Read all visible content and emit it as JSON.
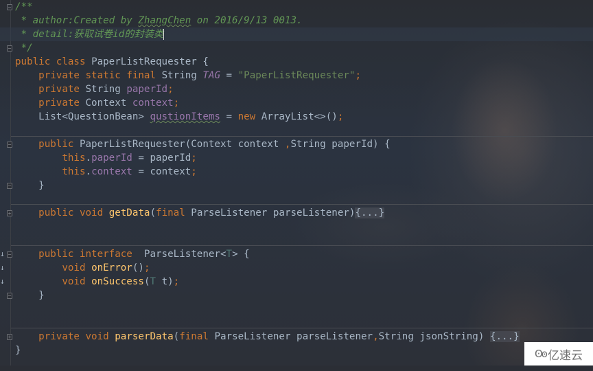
{
  "editor": {
    "theme": "dark",
    "colors": {
      "keyword": "#cc7832",
      "comment": "#629755",
      "string": "#6a8759",
      "field": "#9876aa",
      "method": "#ffc66d",
      "default": "#a9b7c6"
    },
    "lines": {
      "l1": {
        "text": "/**"
      },
      "l2": {
        "star": " * ",
        "tag": "author:",
        "text1": "Created by ",
        "name": "ZhangChen",
        "text2": " on 2016/9/13 0013."
      },
      "l3": {
        "star": " * ",
        "tag": "detail:",
        "text": "获取试卷id的封装类"
      },
      "l4": {
        "text": " */"
      },
      "l5": {
        "kw1": "public",
        "kw2": "class",
        "name": "PaperListRequester",
        "brace": " {"
      },
      "l6": {
        "indent": "    ",
        "kw1": "private",
        "kw2": "static",
        "kw3": "final",
        "type": "String",
        "const": "TAG",
        "eq": " = ",
        "str": "\"PaperListRequester\"",
        "end": ";"
      },
      "l7": {
        "indent": "    ",
        "kw": "private",
        "type": "String",
        "field": "paperId",
        "end": ";"
      },
      "l8": {
        "indent": "    ",
        "kw": "private",
        "type": "Context",
        "field": "context",
        "end": ";"
      },
      "l9": {
        "indent": "    ",
        "type": "List<QuestionBean> ",
        "field": "qustionItems",
        "eq": " = ",
        "kw": "new",
        "rest": " ArrayList<>()",
        "end": ";"
      },
      "l11": {
        "indent": "    ",
        "kw": "public",
        "rest": " PaperListRequester(Context context ",
        "comma": ",",
        "rest2": "String paperId) {"
      },
      "l12": {
        "indent": "        ",
        "kw": "this",
        "dot": ".",
        "field": "paperId",
        "rest": " = paperId",
        "end": ";"
      },
      "l13": {
        "indent": "        ",
        "kw": "this",
        "dot": ".",
        "field": "context",
        "rest": " = context",
        "end": ";"
      },
      "l14": {
        "indent": "    ",
        "text": "}"
      },
      "l16": {
        "indent": "    ",
        "kw1": "public",
        "kw2": "void",
        "method": "getData",
        "open": "(",
        "kw3": "final",
        "rest": " ParseListener parseListener)",
        "folded": "{...}"
      },
      "l19": {
        "indent": "    ",
        "kw1": "public",
        "kw2": "interface",
        "rest": "  ParseListener<",
        "tp": "T",
        "rest2": "> {"
      },
      "l20": {
        "indent": "        ",
        "kw": "void",
        "method": "onError",
        "rest": "()",
        "end": ";"
      },
      "l21": {
        "indent": "        ",
        "kw": "void",
        "method": "onSuccess",
        "open": "(",
        "tp": "T",
        "rest": " t)",
        "end": ";"
      },
      "l22": {
        "indent": "    ",
        "text": "}"
      },
      "l25": {
        "indent": "    ",
        "kw1": "private",
        "kw2": "void",
        "method": "parserData",
        "open": "(",
        "kw3": "final",
        "rest": " ParseListener parseListener",
        "comma": ",",
        "rest2": "String jsonString) ",
        "folded": "{...}"
      },
      "l26": {
        "text": "}"
      }
    },
    "gutter": {
      "fold_collapse": "−",
      "fold_expand": "+",
      "implemented_arrow": "↓"
    }
  },
  "watermark": {
    "logo": "Ꙩꙩ",
    "text": "亿速云"
  }
}
